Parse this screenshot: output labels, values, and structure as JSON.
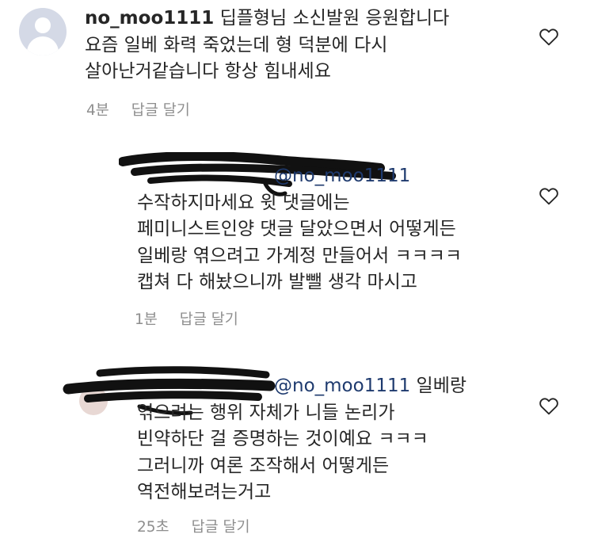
{
  "comments": [
    {
      "username": "no_moo1111",
      "text_line1": " 딥플형님 소신발원 응원합니다",
      "text_line2": "요즘 일베 화력 죽었는데 형 덕분에 다시",
      "text_line3": "살아난거같습니다 항상 힘내세요",
      "time": "4분",
      "reply_label": "답글 달기"
    },
    {
      "mention": "@no_moo1111",
      "text_line1": "수작하지마세요 윗 댓글에는",
      "text_line2": "페미니스트인양 댓글 달았으면서 어떻게든",
      "text_line3": "일베랑 엮으려고 가계정 만들어서 ㅋㅋㅋㅋ",
      "text_line4": "캡쳐 다 해놨으니까 발뺄 생각 마시고",
      "time": "1분",
      "reply_label": "답글 달기"
    },
    {
      "mention": "@no_moo1111",
      "text_line1_rest": " 일베랑",
      "text_line2": "엮으려는 행위 자체가 니들 논리가",
      "text_line3": "빈약하단 걸 증명하는 것이예요 ㅋㅋㅋ",
      "text_line4": "그러니까 여론 조작해서 어떻게든",
      "text_line5": "역전해보려는거고",
      "time": "25초",
      "reply_label": "답글 달기"
    }
  ],
  "colors": {
    "text": "#262626",
    "meta": "#8e8e8e",
    "mention": "#1e3a6e",
    "avatar_bg": "#d4d9e6",
    "redaction": "#111111"
  },
  "icons": [
    "avatar-placeholder-icon",
    "heart-icon"
  ]
}
